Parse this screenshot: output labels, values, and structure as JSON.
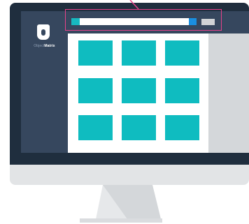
{
  "app": {
    "logo_text_light": "Object",
    "logo_text_bold": "Matrix"
  },
  "colors": {
    "bezel": "#1f2e3e",
    "sidebar": "#36475e",
    "tile": "#0fbcc0",
    "highlight": "#e8428a",
    "search_button": "#1a8fe0",
    "search_accent": "#17b9c0",
    "chin": "#e2e4e6"
  },
  "icons": {
    "logo": "object-matrix-logo-icon"
  },
  "grid": {
    "rows": 3,
    "columns": 3,
    "tiles": [
      "tile-1",
      "tile-2",
      "tile-3",
      "tile-4",
      "tile-5",
      "tile-6",
      "tile-7",
      "tile-8",
      "tile-9"
    ]
  },
  "search": {
    "value": "",
    "placeholder": ""
  }
}
